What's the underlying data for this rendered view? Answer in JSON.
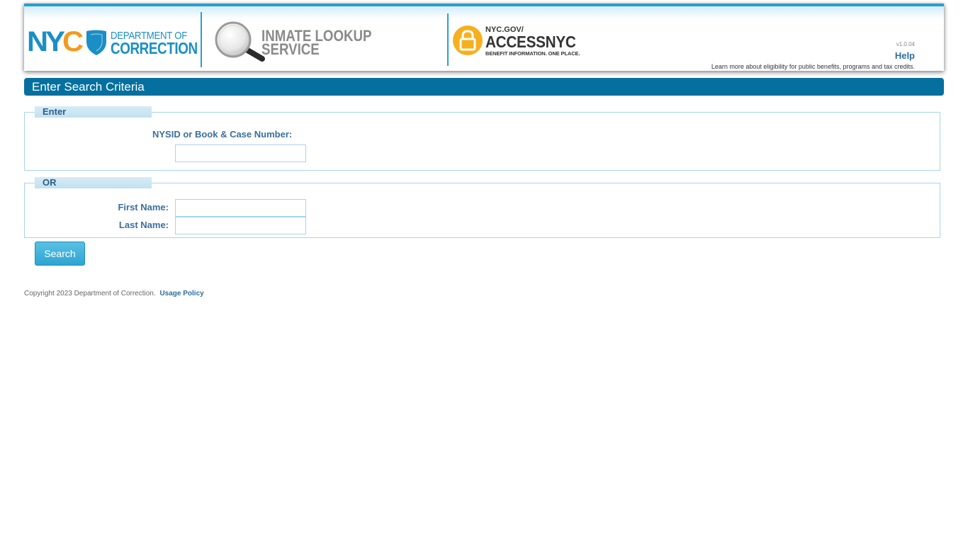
{
  "header": {
    "nyc_logo_text": "NYC",
    "department_line1": "DEPARTMENT OF",
    "department_line2": "CORRECTION",
    "service_line1": "INMATE LOOKUP",
    "service_line2": "SERVICE",
    "access_line1": "NYC.GOV/",
    "access_line2": "ACCESSNYC",
    "access_line3": "BENEFIT INFORMATION. ONE PLACE.",
    "version": "v1.0.04",
    "help_label": "Help",
    "learn_more": "Learn more about eligibility for public benefits, programs and tax credits."
  },
  "title_bar": {
    "title": "Enter Search Criteria"
  },
  "enter_section": {
    "legend": "Enter",
    "nysid_label": "NYSID or Book & Case Number:",
    "nysid_value": ""
  },
  "or_section": {
    "legend": "OR",
    "first_name_label": "First Name:",
    "first_name_value": "",
    "last_name_label": "Last Name:",
    "last_name_value": ""
  },
  "actions": {
    "search_label": "Search"
  },
  "footer": {
    "copyright": "Copyright 2023 Department of Correction.",
    "usage_policy": "Usage Policy"
  },
  "colors": {
    "brand_blue": "#05709f",
    "accent_blue": "#2a9fd0",
    "access_yellow": "#f6b01e",
    "nyc_orange": "#f39a21"
  },
  "icons": {
    "nyc": "nyc-logo-icon",
    "shield": "doc-shield-icon",
    "magnifier": "magnifying-glass-icon",
    "access": "accessnyc-lock-icon"
  }
}
